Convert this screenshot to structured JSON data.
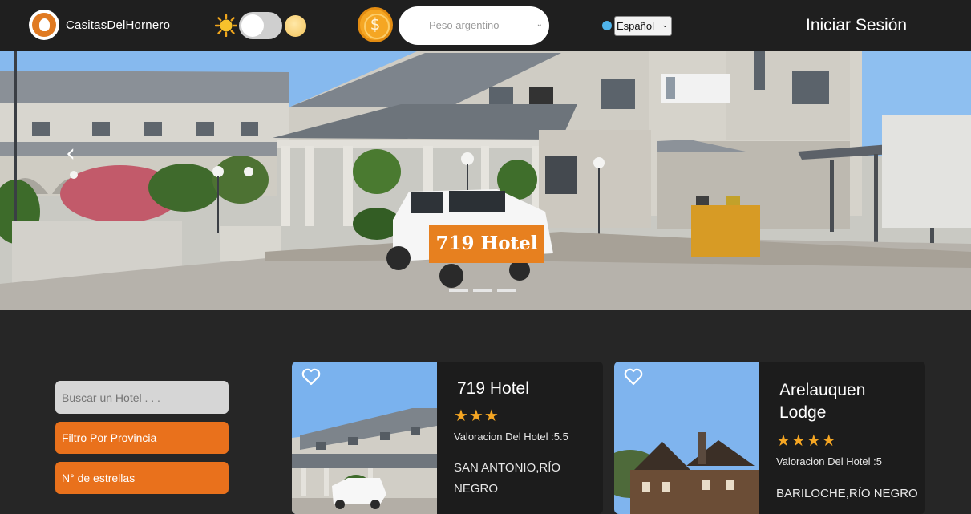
{
  "header": {
    "brand": "CasitasDelHornero",
    "currency_symbol": "$",
    "currency_selected": "Peso argentino",
    "language_selected": "Español",
    "login_label": "Iniciar Sesión"
  },
  "hero": {
    "badge_text": "719 Hotel",
    "prev_arrow": "‹"
  },
  "sidebar": {
    "search_placeholder": "Buscar un Hotel . . .",
    "filter_province_label": "Filtro Por Provincia",
    "filter_stars_label": "N° de estrellas"
  },
  "hotels": [
    {
      "name": "719 Hotel",
      "stars": "★★★",
      "rating_text": "Valoracion Del Hotel :5.5",
      "location": "SAN ANTONIO,RÍO NEGRO"
    },
    {
      "name": "Arelauquen Lodge",
      "stars": "★★★★",
      "rating_text": "Valoracion Del Hotel :5",
      "location": "BARILOCHE,RÍO NEGRO"
    }
  ],
  "colors": {
    "accent": "#e9711c",
    "header_bg": "#1f1f1f",
    "page_bg": "#262626",
    "star": "#f5a623"
  },
  "icons": [
    "logo-bird-icon",
    "sun-icon",
    "moon-icon",
    "coin-icon",
    "globe-icon",
    "chevron-down-icon",
    "heart-icon"
  ]
}
